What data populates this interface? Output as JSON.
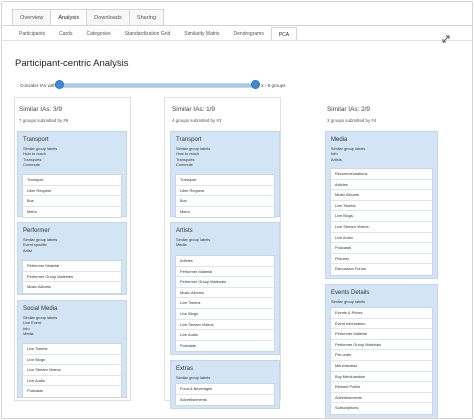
{
  "main_tabs": [
    "Overview",
    "Analysis",
    "Downloads",
    "Sharing"
  ],
  "sub_tabs": [
    "Participants",
    "Cards",
    "Categories",
    "Standardization Grid",
    "Similarity Matrix",
    "Dendrograms",
    "PCA"
  ],
  "page": {
    "title": "Participant-centric Analysis",
    "consider_label": "Consider IAs with",
    "range_label": "2 - 8 groups"
  },
  "columns": [
    {
      "head": "Similar IAs: 3/9",
      "sub": "7 groups submitted by #6",
      "groups": [
        {
          "title": "Transport",
          "labels_heading": "Similar group labels",
          "labels": [
            "How to reach",
            "Transports",
            "Commute"
          ],
          "items": [
            "Transport",
            "Uber Request",
            "Bus",
            "Metro"
          ]
        },
        {
          "title": "Performer",
          "labels_heading": "Similar group labels",
          "labels": [
            "Event specific",
            "Artist"
          ],
          "items": [
            "Performer Material",
            "Performer Group Materials",
            "Music Albums"
          ]
        },
        {
          "title": "Social Media",
          "labels_heading": "Similar group labels",
          "labels": [
            "Live Event",
            "Info",
            "Media"
          ],
          "items": [
            "Live Tweets",
            "Live Blogs",
            "Live Stream Videos",
            "Live Audio",
            "Podcasts"
          ]
        }
      ]
    },
    {
      "head": "Similar IAs: 1/9",
      "sub": "4 groups submitted by #3",
      "groups": [
        {
          "title": "Transport",
          "labels_heading": "Similar group labels",
          "labels": [
            "How to reach",
            "Transports",
            "Commute"
          ],
          "items": [
            "Transport",
            "Uber Request",
            "Bus",
            "Metro"
          ]
        },
        {
          "title": "Artists",
          "labels_heading": "Similar group labels",
          "labels": [
            "Media"
          ],
          "items": [
            "Articles",
            "Performer Material",
            "Performer Group Materials",
            "Music Albums",
            "Live Tweets",
            "Live Blogs",
            "Live Stream Videos",
            "Live Audio",
            "Podcasts"
          ]
        },
        {
          "title": "Extras",
          "labels_heading": "Similar group labels",
          "labels": [],
          "items": [
            "Food & Beverages",
            "Advertisements"
          ]
        }
      ]
    },
    {
      "head": "Similar IAs: 2/9",
      "sub": "3 groups submitted by #4",
      "groups": [
        {
          "title": "Media",
          "labels_heading": "Similar group labels",
          "labels": [
            "Info",
            "Artists"
          ],
          "items": [
            "Recommendations",
            "Articles",
            "Music Albums",
            "Live Tweets",
            "Live Blogs",
            "Live Stream Videos",
            "Live Audio",
            "Podcasts",
            "Pictures",
            "Discussion Forum"
          ]
        },
        {
          "title": "Events Details",
          "labels_heading": "Similar group labels",
          "labels": [],
          "items": [
            "Events & Prices",
            "Event Information",
            "Performer Material",
            "Performer Group Materials",
            "Pre-order",
            "Merchandise",
            "Buy Merchandise",
            "Reward Points",
            "Advertisements",
            "Subscriptions"
          ]
        }
      ]
    }
  ]
}
